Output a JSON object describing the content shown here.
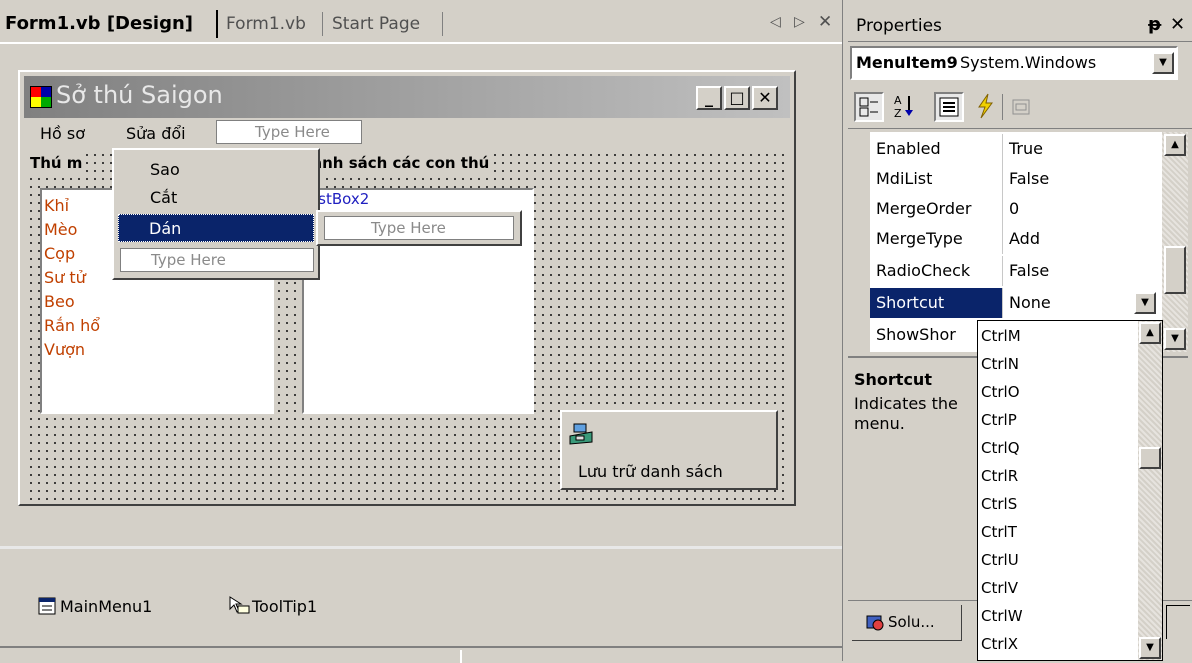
{
  "tabs": {
    "design": "Form1.vb [Design]",
    "code": "Form1.vb",
    "start": "Start Page",
    "nav_left": "◁",
    "nav_right": "▷",
    "close": "✕"
  },
  "form": {
    "title": "Sở thú Saigon",
    "menu": [
      "Hồ sơ",
      "Sửa đổi"
    ],
    "menu_typehere": "Type Here",
    "label1": "Thú m",
    "label2": "anh sách các con thú",
    "listbox1": [
      "Khỉ",
      "Mèo",
      "Cọp",
      "Sư tử",
      "Beo",
      "Rắn hổ",
      "Vượn"
    ],
    "listbox2": "istBox2",
    "dropdown": [
      "Sao",
      "Cắt",
      "Dán"
    ],
    "dropdown_typehere": "Type Here",
    "submenu_typehere": "Type Here",
    "button": "Lưu trữ danh sách"
  },
  "tray": {
    "item1": "MainMenu1",
    "item2": "ToolTip1"
  },
  "properties": {
    "title": "Properties",
    "pin": "ᵽ",
    "close": "✕",
    "object_name": "MenuItem9",
    "object_type": "System.Windows",
    "rows": [
      {
        "name": "Enabled",
        "value": "True"
      },
      {
        "name": "MdiList",
        "value": "False"
      },
      {
        "name": "MergeOrder",
        "value": "0"
      },
      {
        "name": "MergeType",
        "value": "Add"
      },
      {
        "name": "RadioCheck",
        "value": "False"
      },
      {
        "name": "Shortcut",
        "value": "None"
      },
      {
        "name": "ShowShor",
        "value": ""
      }
    ],
    "desc_title": "Shortcut",
    "desc_line1": "Indicates the",
    "desc_line2": "menu.",
    "solution_tab": "Solu..."
  },
  "shortcut_options": [
    "CtrlM",
    "CtrlN",
    "CtrlO",
    "CtrlP",
    "CtrlQ",
    "CtrlR",
    "CtrlS",
    "CtrlT",
    "CtrlU",
    "CtrlV",
    "CtrlW",
    "CtrlX"
  ],
  "colors": {
    "selection": "#0a246a",
    "list_item": "#c04000",
    "title_grad_start": "#808080",
    "title_grad_end": "#c0c0c0"
  }
}
